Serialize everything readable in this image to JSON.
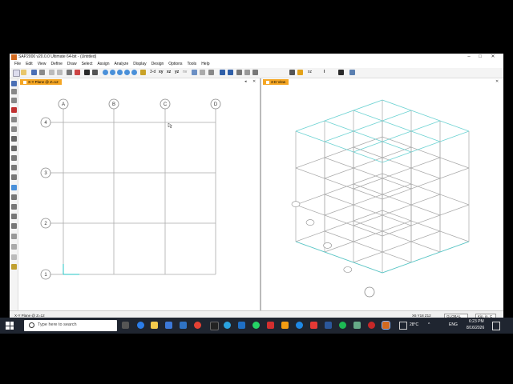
{
  "window": {
    "title": "SAP2000 v20.0.0 Ultimate 64-bit - (Untitled)",
    "minimize": "–",
    "maximize": "□",
    "close": "✕"
  },
  "menu": [
    "File",
    "Edit",
    "View",
    "Define",
    "Draw",
    "Select",
    "Assign",
    "Analyze",
    "Display",
    "Design",
    "Options",
    "Tools",
    "Help"
  ],
  "toolbar": {
    "view_3d": "3-d",
    "view_xy": "xy",
    "view_xz": "xz",
    "view_yz": "yz",
    "view_nv": "nv",
    "xz_drop": "xz",
    "i_text": "I"
  },
  "left_pane": {
    "tab_title": "X-Y Plane @ Z=12",
    "pin": "◂",
    "close": "✕",
    "grid_x": [
      "A",
      "B",
      "C",
      "D"
    ],
    "grid_y": [
      "4",
      "3",
      "2",
      "1"
    ]
  },
  "right_pane": {
    "tab_title": "3-D View",
    "close": "✕"
  },
  "status": {
    "left": "X-Y Plane @ Z=12",
    "coords": "X6  Y18  Z12",
    "system": "GLOBAL",
    "units": "Kip, in, C"
  },
  "taskbar": {
    "search_placeholder": "Type here to search",
    "temperature": "28°C",
    "time": "6:23 PM",
    "date": "8/16/2026",
    "lang": "ENG"
  }
}
